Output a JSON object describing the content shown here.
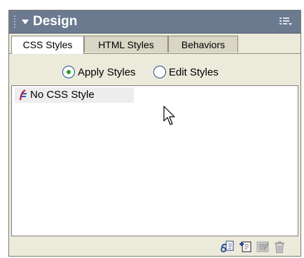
{
  "panel": {
    "title": "Design",
    "tabs": [
      {
        "label": "CSS Styles",
        "active": true
      },
      {
        "label": "HTML Styles",
        "active": false
      },
      {
        "label": "Behaviors",
        "active": false
      }
    ],
    "mode_options": [
      {
        "label": "Apply Styles",
        "selected": true
      },
      {
        "label": "Edit Styles",
        "selected": false
      }
    ],
    "style_list": [
      {
        "label": "No CSS Style",
        "icon": "no-style-icon"
      }
    ],
    "toolbar_icons": [
      "attach-stylesheet-icon",
      "new-style-icon",
      "edit-style-icon",
      "delete-icon"
    ]
  }
}
